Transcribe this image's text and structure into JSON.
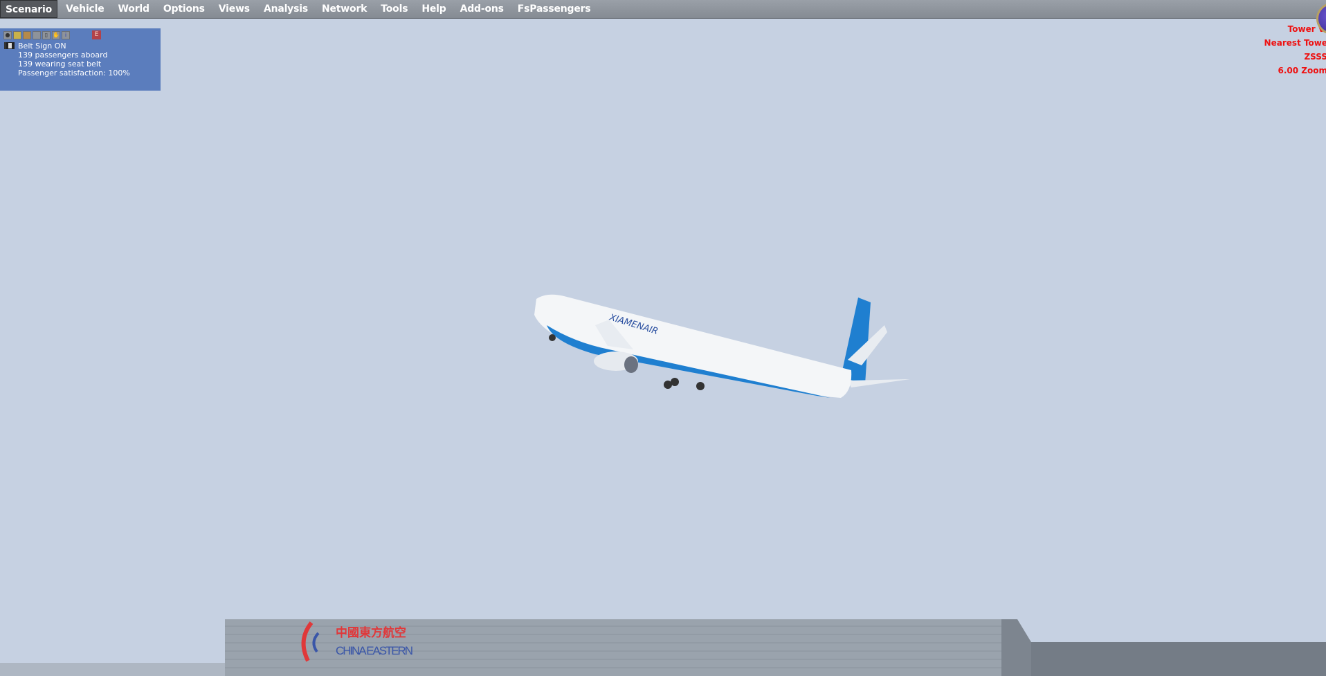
{
  "menu": {
    "items": [
      "Scenario",
      "Vehicle",
      "World",
      "Options",
      "Views",
      "Analysis",
      "Network",
      "Tools",
      "Help",
      "Add-ons",
      "FsPassengers"
    ],
    "active": "Scenario"
  },
  "fspassengers_panel": {
    "toolbar_icons": [
      "eye-icon",
      "card-icon",
      "food-icon",
      "printer-icon",
      "document-icon",
      "hand-icon",
      "info-icon"
    ],
    "exit_label": "E",
    "belt_sign": "Belt Sign ON",
    "passengers_aboard": "139 passengers aboard",
    "wearing_seat_belt": "139 wearing seat belt",
    "satisfaction": "Passenger satisfaction: 100%"
  },
  "view_info": {
    "line1": "Tower Vi",
    "line2": "Nearest Towe",
    "line3": "ZSSS",
    "line4": "6.00 Zoom"
  },
  "scene": {
    "aircraft_livery": "XIAMENAIR",
    "building_sign": "CHINA EASTERN",
    "building_sign_cn": "中國東方航空",
    "sky_color": "#c6d1e2",
    "livery_blue": "#1f7fd0"
  }
}
